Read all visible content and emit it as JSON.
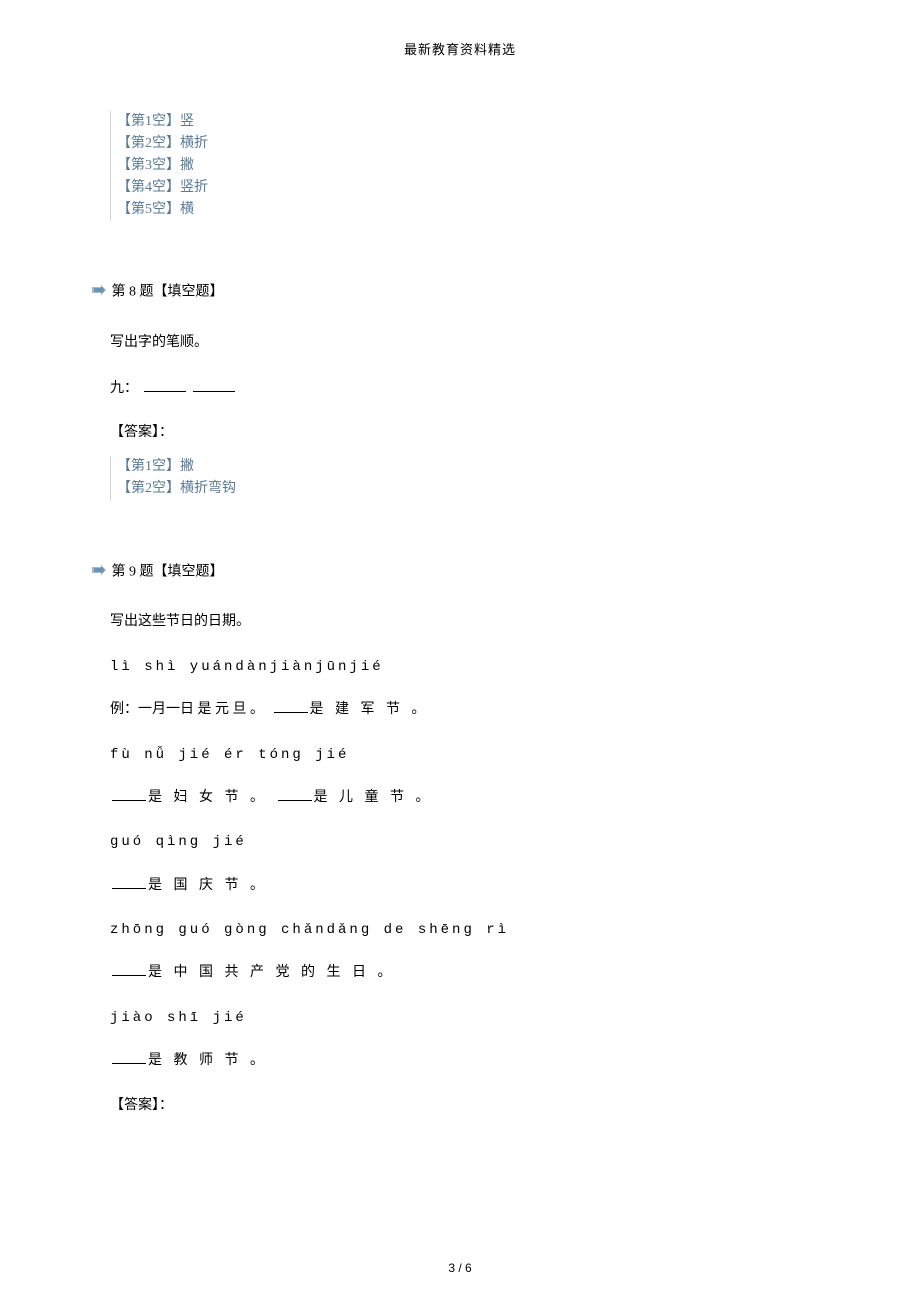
{
  "header": {
    "title": "最新教育资料精选"
  },
  "q7_answers": {
    "a1": "【第1空】竖",
    "a2": "【第2空】横折",
    "a3": "【第3空】撇",
    "a4": "【第4空】竖折",
    "a5": "【第5空】横"
  },
  "q8": {
    "heading_prefix": "第 ",
    "heading_num": "8",
    "heading_suffix": " 题【填空题】",
    "prompt": "写出字的笔顺。",
    "char_label": "九：",
    "answer_label": "【答案】：",
    "answers": {
      "a1": "【第1空】撇",
      "a2": "【第2空】横折弯钩"
    }
  },
  "q9": {
    "heading_prefix": "第 ",
    "heading_num": "9",
    "heading_suffix": " 题【填空题】",
    "prompt": "写出这些节日的日期。",
    "lines": {
      "p1": "lì shì yuándànjiànjūnjié",
      "c1a": "例：一月一日   是 元 旦 。",
      "c1b": "是 建 军 节 。",
      "p2": "fù nǚ jié ér tónɡ jié",
      "c2a": "是 妇 女 节 。",
      "c2b": "是 儿 童 节 。",
      "p3": "ɡuó qìnɡ jié",
      "c3": "是 国 庆 节 。",
      "p4": "zhōnɡ ɡuó ɡònɡ chǎndǎnɡ de shēnɡ rì",
      "c4": "是 中 国 共 产 党 的 生 日 。",
      "p5": "jiào shī jié",
      "c5": "是 教 师 节 。"
    },
    "answer_label": "【答案】："
  },
  "footer": {
    "text": "3 / 6"
  }
}
